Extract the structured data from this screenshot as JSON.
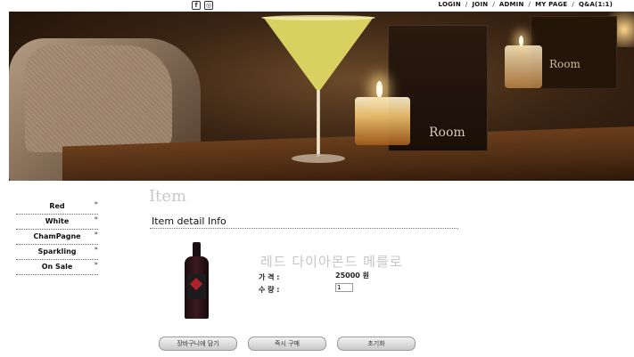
{
  "header": {
    "social_icons": [
      "facebook-icon",
      "instagram-icon"
    ],
    "nav": [
      "LOGIN",
      "JOIN",
      "ADMIN",
      "MY PAGE",
      "Q&A(1:1)"
    ]
  },
  "banner": {
    "logo_main": "Room",
    "logo_secondary": "Room"
  },
  "sidebar": {
    "items": [
      {
        "label": "Red"
      },
      {
        "label": "White"
      },
      {
        "label": "ChamPagne"
      },
      {
        "label": "Sparkling"
      },
      {
        "label": "On Sale"
      }
    ],
    "arrow": "»"
  },
  "main": {
    "section_title": "Item",
    "subtitle": "Item detail Info",
    "product": {
      "name": "레드 다이아몬드 메를로",
      "price_label": "가 격 :",
      "price_value": "25000 원",
      "qty_label": "수 량 :",
      "qty_value": "1"
    },
    "buttons": {
      "add_to_cart": "장바구니에 담기",
      "buy_now": "즉시 구매",
      "reset": "초기화"
    }
  }
}
